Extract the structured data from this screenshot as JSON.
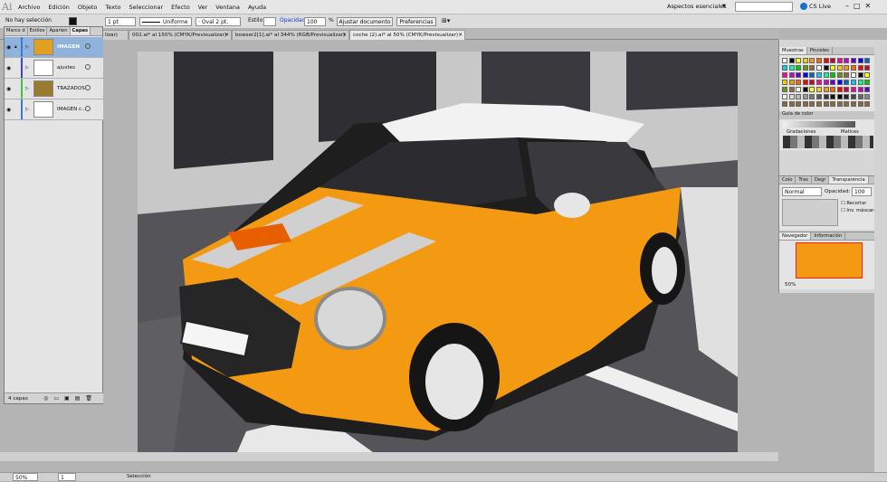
{
  "app": {
    "logo": "Ai"
  },
  "menu": [
    "Archivo",
    "Edición",
    "Objeto",
    "Texto",
    "Seleccionar",
    "Efecto",
    "Ver",
    "Ventana",
    "Ayuda"
  ],
  "workspace": "Aspectos esenciales",
  "search": {
    "value": "",
    "placeholder": ""
  },
  "cslive": "CS Live",
  "control": {
    "selection": "No hay selección",
    "stroke_weight": "1 pt",
    "profile": "Uniforme",
    "brush": "Oval 2 pt.",
    "style_label": "Estilo",
    "opacity_label": "Opacidad:",
    "opacity_value": "100",
    "opacity_unit": "%",
    "doc_setup": "Ajustar documento",
    "prefs": "Preferencias"
  },
  "tabs": [
    "lizar)",
    "002.ai* al 150% (CMYK/Previsualizar)",
    "bowser2[1].ai* al 344% (RGB/Previsualizar)",
    "coche (2).ai* al 50% (CMYK/Previsualizar)"
  ],
  "layers": {
    "tabs": [
      "Marco d",
      "Estilos",
      "Aparien",
      "Capas"
    ],
    "rows": [
      {
        "name": "IMAGEN",
        "color": "#3c78d8"
      },
      {
        "name": "ajustes",
        "color": "#4040e0"
      },
      {
        "name": "TRAZADOS",
        "color": "#3ec83e"
      },
      {
        "name": "IMAGEN c...",
        "color": "#3c78d8"
      }
    ],
    "count": "4 capas"
  },
  "swatches": {
    "tabs": [
      "Muestras",
      "Pinceles"
    ],
    "guide_title": "Guía de color",
    "gradaciones": "Gradaciones",
    "matices": "Matices",
    "colors": [
      "#ffffff",
      "#000000",
      "#ffff00",
      "#ffcc00",
      "#ff9900",
      "#ff6600",
      "#ff0000",
      "#cc0033",
      "#ff0099",
      "#cc00cc",
      "#6600cc",
      "#0000ff",
      "#0066cc",
      "#00ccff",
      "#00ff99",
      "#00cc00",
      "#669900",
      "#996633"
    ]
  },
  "transparency": {
    "tabs": [
      "Colo",
      "Tras",
      "Degr",
      "Transparencia"
    ],
    "mode": "Normal",
    "opacity_label": "Opacidad:",
    "opacity_value": "100",
    "clip": "Recortar",
    "invert": "Inv. máscara"
  },
  "navigator": {
    "tabs": [
      "Navegador",
      "Información"
    ],
    "zoom": "50%"
  },
  "status": {
    "zoom": "50%",
    "artboard": "1",
    "tool": "Selección"
  }
}
